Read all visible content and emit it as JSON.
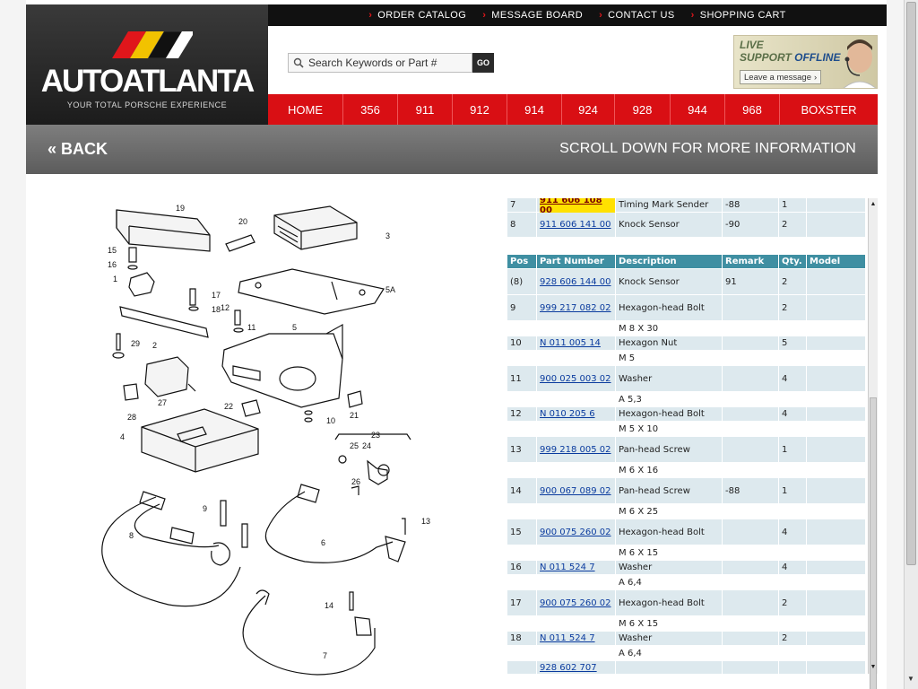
{
  "brand": {
    "name": "AUTOATLANTA",
    "tagline": "YOUR TOTAL PORSCHE EXPERIENCE"
  },
  "topnav": [
    {
      "label": "ORDER CATALOG"
    },
    {
      "label": "MESSAGE BOARD"
    },
    {
      "label": "CONTACT US"
    },
    {
      "label": "SHOPPING CART"
    }
  ],
  "search": {
    "placeholder": "Search Keywords or Part #",
    "value": "",
    "go_label": "GO"
  },
  "live_support": {
    "line1": "LIVE",
    "line2a": "SUPPORT",
    "line2b": "OFFLINE",
    "message_button": "Leave a message"
  },
  "main_nav": [
    {
      "label": "HOME"
    },
    {
      "label": "356"
    },
    {
      "label": "911"
    },
    {
      "label": "912"
    },
    {
      "label": "914"
    },
    {
      "label": "924"
    },
    {
      "label": "928"
    },
    {
      "label": "944"
    },
    {
      "label": "968"
    },
    {
      "label": "BOXSTER"
    }
  ],
  "backbar": {
    "back_label": "« BACK",
    "scroll_hint": "SCROLL DOWN FOR MORE INFORMATION"
  },
  "diagram_callouts": [
    "19",
    "20",
    "3",
    "15",
    "16",
    "1",
    "17",
    "18",
    "12",
    "11",
    "5A",
    "5",
    "29",
    "2",
    "27",
    "28",
    "22",
    "9",
    "10",
    "21",
    "4",
    "23",
    "25",
    "24",
    "26",
    "8",
    "6",
    "13",
    "14",
    "7"
  ],
  "parts_table": {
    "top_rows": [
      {
        "pos": "7",
        "part_number": "911 606 108 00",
        "description": "Timing Mark Sender",
        "remark": "-88",
        "qty": "1",
        "model": "",
        "highlight": true
      },
      {
        "pos": "8",
        "part_number": "911 606 141 00",
        "description": "Knock Sensor",
        "remark": "-90",
        "qty": "2",
        "model": ""
      }
    ],
    "headers": {
      "pos": "Pos",
      "part_number": "Part Number",
      "description": "Description",
      "remark": "Remark",
      "qty": "Qty.",
      "model": "Model"
    },
    "rows": [
      {
        "pos": "(8)",
        "part_number": "928 606 144 00",
        "description": "Knock Sensor",
        "remark": "91",
        "qty": "2",
        "spec": ""
      },
      {
        "pos": "9",
        "part_number": "999 217 082 02",
        "description": "Hexagon-head Bolt",
        "remark": "",
        "qty": "2",
        "spec": "M 8 X 30"
      },
      {
        "pos": "10",
        "part_number": "N 011 005 14",
        "description": "Hexagon Nut",
        "remark": "",
        "qty": "5",
        "spec": "M 5"
      },
      {
        "pos": "11",
        "part_number": "900 025 003 02",
        "description": "Washer",
        "remark": "",
        "qty": "4",
        "spec": "A 5,3"
      },
      {
        "pos": "12",
        "part_number": "N 010 205 6",
        "description": "Hexagon-head Bolt",
        "remark": "",
        "qty": "4",
        "spec": "M 5 X 10"
      },
      {
        "pos": "13",
        "part_number": "999 218 005 02",
        "description": "Pan-head Screw",
        "remark": "",
        "qty": "1",
        "spec": "M 6 X 16"
      },
      {
        "pos": "14",
        "part_number": "900 067 089 02",
        "description": "Pan-head Screw",
        "remark": "-88",
        "qty": "1",
        "spec": "M 6 X 25"
      },
      {
        "pos": "15",
        "part_number": "900 075 260 02",
        "description": "Hexagon-head Bolt",
        "remark": "",
        "qty": "4",
        "spec": "M 6 X 15"
      },
      {
        "pos": "16",
        "part_number": "N 011 524 7",
        "description": "Washer",
        "remark": "",
        "qty": "4",
        "spec": "A 6,4"
      },
      {
        "pos": "17",
        "part_number": "900 075 260 02",
        "description": "Hexagon-head Bolt",
        "remark": "",
        "qty": "2",
        "spec": "M 6 X 15"
      },
      {
        "pos": "18",
        "part_number": "N 011 524 7",
        "description": "Washer",
        "remark": "",
        "qty": "2",
        "spec": "A 6,4"
      },
      {
        "pos": "",
        "part_number": "928 602 707",
        "description": "",
        "remark": "",
        "qty": "",
        "spec": ""
      }
    ]
  },
  "colors": {
    "red_nav": "#d90f14",
    "header_teal": "#3f8fa2",
    "row_blue": "#dde9ee",
    "highlight": "#ffe100",
    "link": "#0a3b9e"
  },
  "icons": {
    "search": "magnifier-icon",
    "live_support": "headset-agent-icon"
  }
}
